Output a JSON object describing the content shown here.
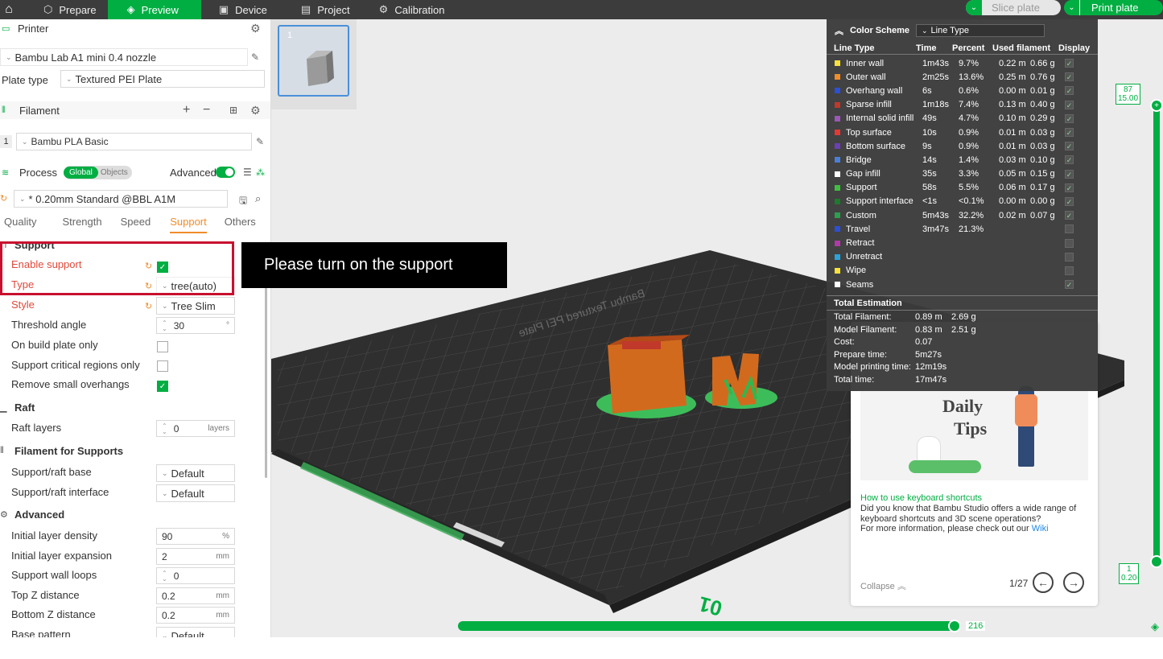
{
  "topbar": {
    "tabs": [
      {
        "label": "Prepare",
        "icon": "cube-icon"
      },
      {
        "label": "Preview",
        "icon": "layers-icon"
      },
      {
        "label": "Device",
        "icon": "device-icon"
      },
      {
        "label": "Project",
        "icon": "project-icon"
      },
      {
        "label": "Calibration",
        "icon": "calibration-icon"
      }
    ],
    "slice_label": "Slice plate",
    "print_label": "Print plate"
  },
  "printer": {
    "section_label": "Printer",
    "name": "Bambu Lab A1 mini 0.4 nozzle",
    "plate_type_label": "Plate type",
    "plate_type": "Textured PEI Plate"
  },
  "filament": {
    "section_label": "Filament",
    "index": "1",
    "name": "Bambu PLA Basic"
  },
  "process": {
    "section_label": "Process",
    "global_label": "Global",
    "objects_label": "Objects",
    "advanced_label": "Advanced",
    "preset": "* 0.20mm Standard @BBL A1M",
    "tabs": [
      "Quality",
      "Strength",
      "Speed",
      "Support",
      "Others"
    ]
  },
  "support": {
    "heading": "Support",
    "enable_label": "Enable support",
    "type_label": "Type",
    "type_value": "tree(auto)",
    "style_label": "Style",
    "style_value": "Tree Slim",
    "threshold_label": "Threshold angle",
    "threshold_value": "30",
    "threshold_unit": "°",
    "build_plate_label": "On build plate only",
    "critical_label": "Support critical regions only",
    "remove_small_label": "Remove small overhangs"
  },
  "raft": {
    "heading": "Raft",
    "layers_label": "Raft layers",
    "layers_value": "0",
    "layers_unit": "layers"
  },
  "filament_supports": {
    "heading": "Filament for Supports",
    "base_label": "Support/raft base",
    "base_value": "Default",
    "interface_label": "Support/raft interface",
    "interface_value": "Default"
  },
  "advanced": {
    "heading": "Advanced",
    "rows": [
      {
        "label": "Initial layer density",
        "value": "90",
        "unit": "%"
      },
      {
        "label": "Initial layer expansion",
        "value": "2",
        "unit": "mm"
      },
      {
        "label": "Support wall loops",
        "value": "0",
        "unit": ""
      },
      {
        "label": "Top Z distance",
        "value": "0.2",
        "unit": "mm"
      },
      {
        "label": "Bottom Z distance",
        "value": "0.2",
        "unit": "mm"
      },
      {
        "label": "Base pattern",
        "value": "Default",
        "unit": ""
      }
    ]
  },
  "callout": "Please turn on the support",
  "color_scheme": {
    "title": "Color Scheme",
    "mode": "Line Type",
    "columns": [
      "Line Type",
      "Time",
      "Percent",
      "Used filament",
      "Display"
    ],
    "rows": [
      {
        "name": "Inner wall",
        "color": "#f7e13a",
        "time": "1m43s",
        "percent": "9.7%",
        "len": "0.22 m",
        "weight": "0.66 g",
        "checked": true
      },
      {
        "name": "Outer wall",
        "color": "#f08c2a",
        "time": "2m25s",
        "percent": "13.6%",
        "len": "0.25 m",
        "weight": "0.76 g",
        "checked": true
      },
      {
        "name": "Overhang wall",
        "color": "#2c4fd3",
        "time": "6s",
        "percent": "0.6%",
        "len": "0.00 m",
        "weight": "0.01 g",
        "checked": true
      },
      {
        "name": "Sparse infill",
        "color": "#c0392b",
        "time": "1m18s",
        "percent": "7.4%",
        "len": "0.13 m",
        "weight": "0.40 g",
        "checked": true
      },
      {
        "name": "Internal solid infill",
        "color": "#9b59b6",
        "time": "49s",
        "percent": "4.7%",
        "len": "0.10 m",
        "weight": "0.29 g",
        "checked": true
      },
      {
        "name": "Top surface",
        "color": "#e53935",
        "time": "10s",
        "percent": "0.9%",
        "len": "0.01 m",
        "weight": "0.03 g",
        "checked": true
      },
      {
        "name": "Bottom surface",
        "color": "#6c3fb5",
        "time": "9s",
        "percent": "0.9%",
        "len": "0.01 m",
        "weight": "0.03 g",
        "checked": true
      },
      {
        "name": "Bridge",
        "color": "#4a7fd6",
        "time": "14s",
        "percent": "1.4%",
        "len": "0.03 m",
        "weight": "0.10 g",
        "checked": true
      },
      {
        "name": "Gap infill",
        "color": "#ffffff",
        "time": "35s",
        "percent": "3.3%",
        "len": "0.05 m",
        "weight": "0.15 g",
        "checked": true
      },
      {
        "name": "Support",
        "color": "#3fbf3f",
        "time": "58s",
        "percent": "5.5%",
        "len": "0.06 m",
        "weight": "0.17 g",
        "checked": true
      },
      {
        "name": "Support interface",
        "color": "#1e7a2e",
        "time": "<1s",
        "percent": "<0.1%",
        "len": "0.00 m",
        "weight": "0.00 g",
        "checked": true
      },
      {
        "name": "Custom",
        "color": "#2e9e4f",
        "time": "5m43s",
        "percent": "32.2%",
        "len": "0.02 m",
        "weight": "0.07 g",
        "checked": true
      },
      {
        "name": "Travel",
        "color": "#2c4fd3",
        "time": "3m47s",
        "percent": "21.3%",
        "len": "",
        "weight": "",
        "checked": false
      },
      {
        "name": "Retract",
        "color": "#b03aa8",
        "time": "",
        "percent": "",
        "len": "",
        "weight": "",
        "checked": false
      },
      {
        "name": "Unretract",
        "color": "#2aa3d9",
        "time": "",
        "percent": "",
        "len": "",
        "weight": "",
        "checked": false
      },
      {
        "name": "Wipe",
        "color": "#f7e13a",
        "time": "",
        "percent": "",
        "len": "",
        "weight": "",
        "checked": false
      },
      {
        "name": "Seams",
        "color": "#ffffff",
        "time": "",
        "percent": "",
        "len": "",
        "weight": "",
        "checked": true
      }
    ],
    "total_heading": "Total Estimation",
    "totals": [
      {
        "label": "Total Filament:",
        "a": "0.89 m",
        "b": "2.69 g"
      },
      {
        "label": "Model Filament:",
        "a": "0.83 m",
        "b": "2.51 g"
      },
      {
        "label": "Cost:",
        "a": "0.07",
        "b": ""
      },
      {
        "label": "Prepare time:",
        "a": "5m27s",
        "b": ""
      },
      {
        "label": "Model printing time:",
        "a": "12m19s",
        "b": ""
      },
      {
        "label": "Total time:",
        "a": "17m47s",
        "b": ""
      }
    ]
  },
  "tips": {
    "image_text_1": "Daily",
    "image_text_2": "Tips",
    "link": "How to use keyboard shortcuts",
    "body": "Did you know that Bambu Studio offers a wide range of keyboard shortcuts and 3D scene operations?",
    "more_prefix": "For more information, please check out our ",
    "wiki": "Wiki",
    "collapse": "Collapse",
    "pager": "1/27"
  },
  "plate": {
    "thumb_index": "1",
    "plate_number": "01",
    "plate_text": "Bambu Textured PEI Plate",
    "layer_end": "216",
    "v_top_layer": "87",
    "v_top_height": "15.00",
    "v_bot_layer": "1",
    "v_bot_height": "0.20"
  }
}
